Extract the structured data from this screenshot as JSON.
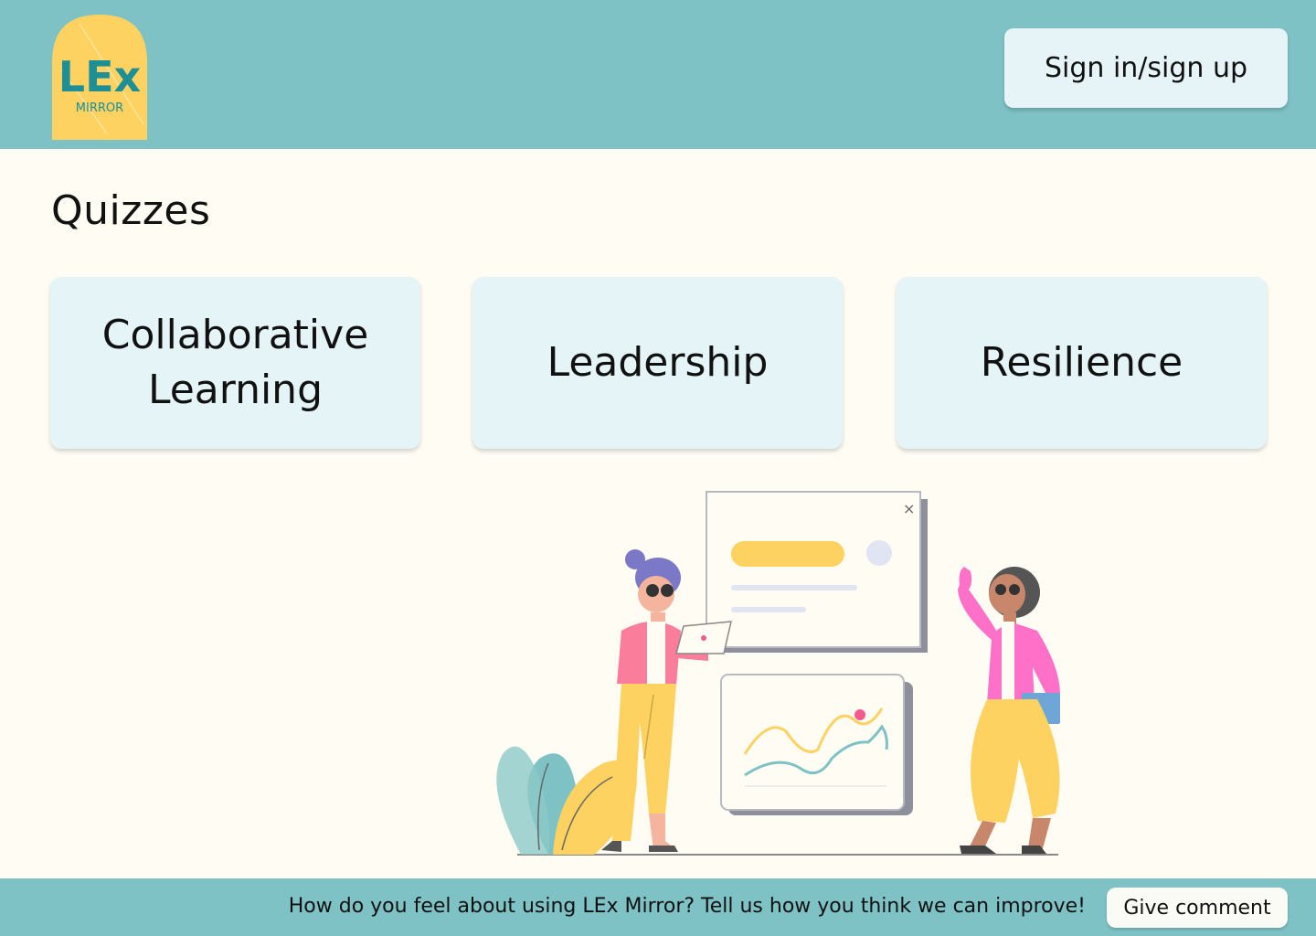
{
  "header": {
    "logo": {
      "text": "LEx",
      "subtext": "MIRROR",
      "icon": "lex-mirror-logo"
    },
    "signin_label": "Sign in/sign up"
  },
  "main": {
    "title": "Quizzes",
    "quizzes": [
      {
        "label": "Collaborative Learning"
      },
      {
        "label": "Leadership"
      },
      {
        "label": "Resilience"
      }
    ],
    "illustration": {
      "icon": "team-presentation-illustration"
    }
  },
  "footer": {
    "feedback_text": "How do you feel about using LEx Mirror? Tell us how you think we can improve!",
    "comment_label": "Give comment"
  },
  "colors": {
    "header_bg": "#7fc2c6",
    "page_bg": "#fffcf4",
    "card_bg": "#e5f4f7",
    "logo_yellow": "#fdd261",
    "logo_teal": "#1f8f96"
  }
}
